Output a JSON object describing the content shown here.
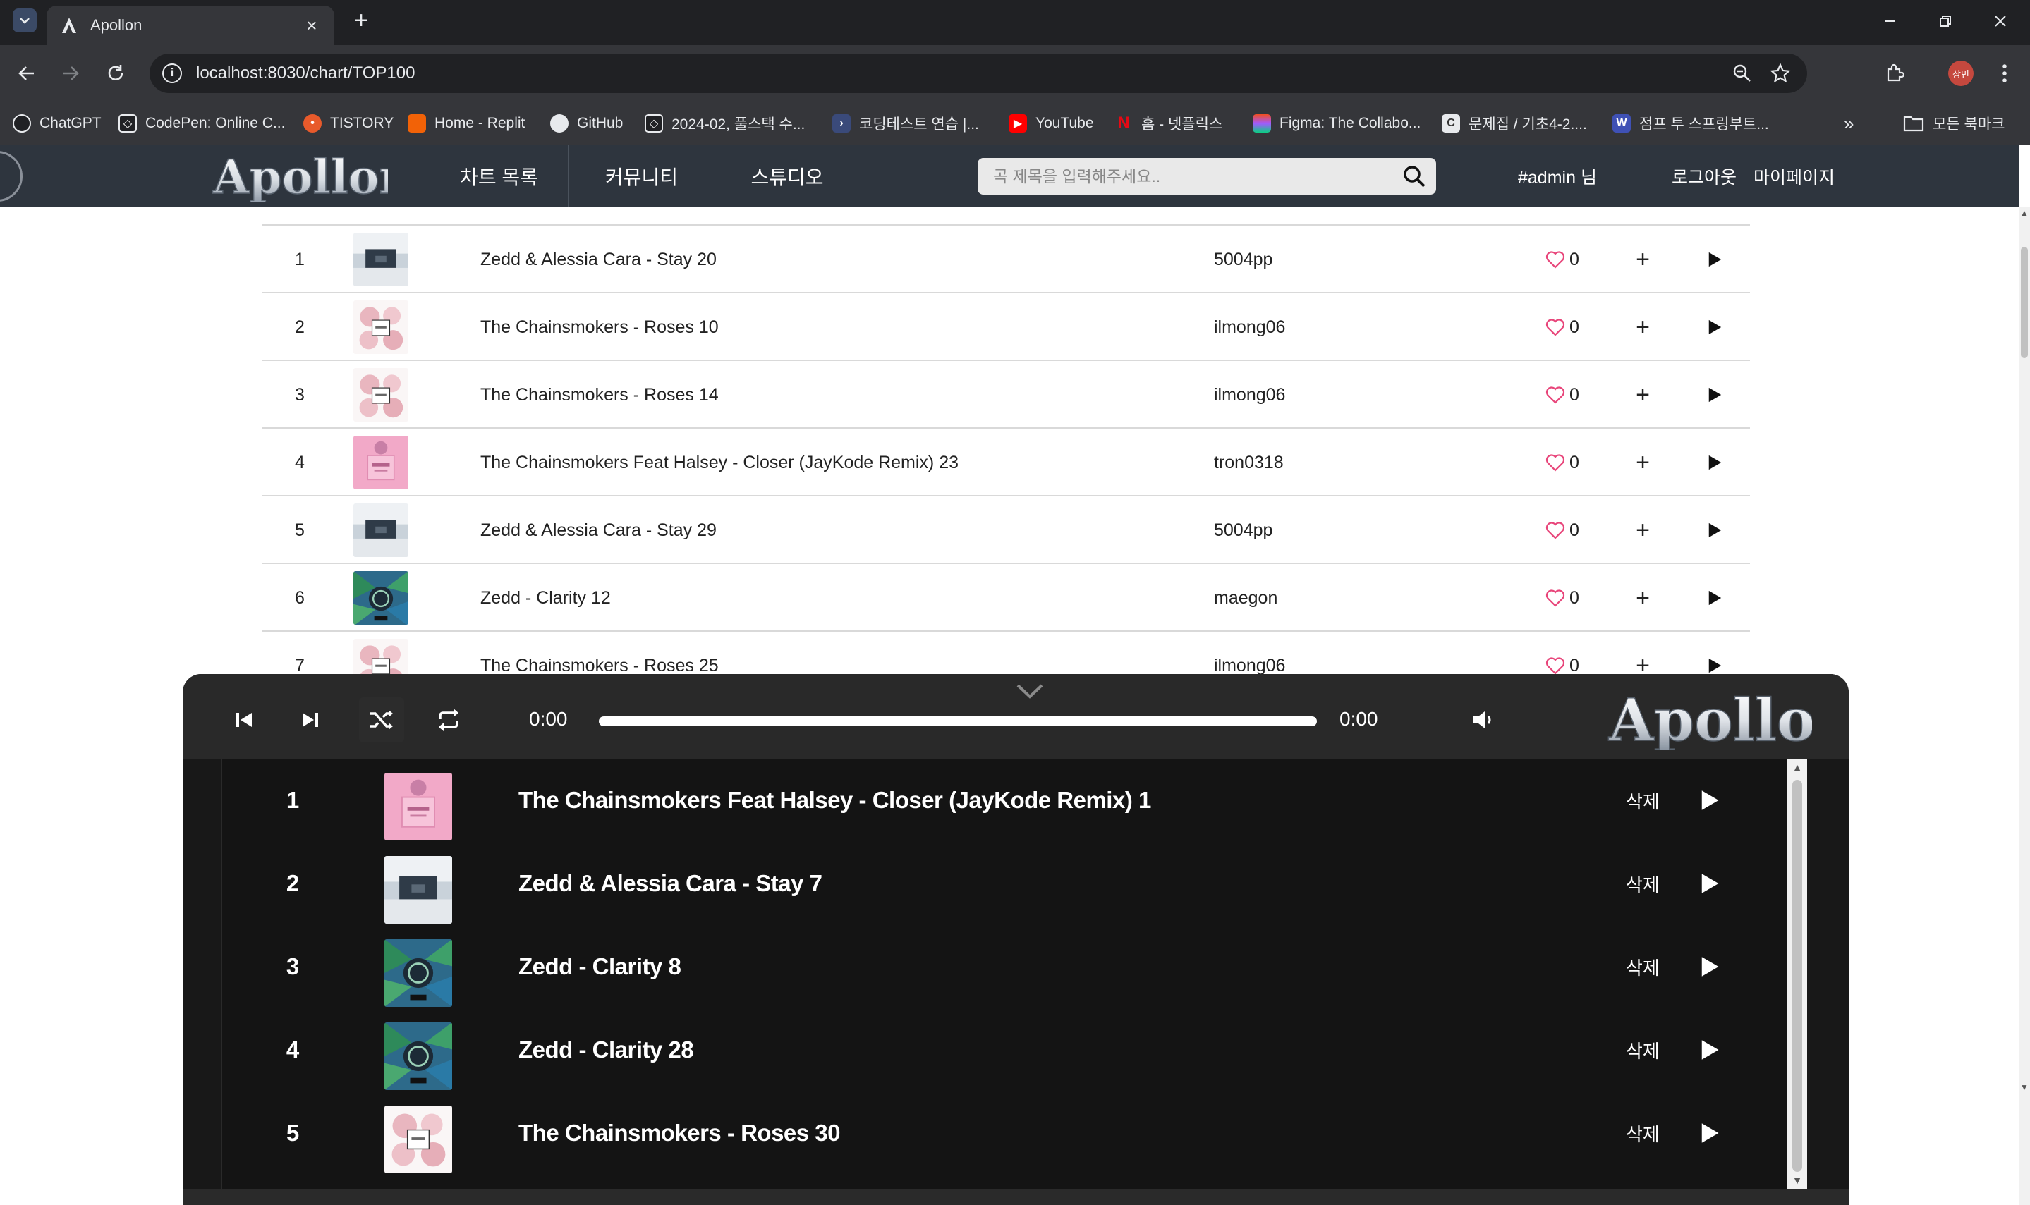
{
  "browser": {
    "tab_title": "Apollon",
    "url": "localhost:8030/chart/TOP100",
    "profile_label": "상민",
    "bookmarks": [
      "ChatGPT",
      "CodePen: Online C...",
      "TISTORY",
      "Home - Replit",
      "GitHub",
      "2024-02, 풀스택 수...",
      "코딩테스트 연습 |...",
      "YouTube",
      "홈 - 넷플릭스",
      "Figma: The Collabo...",
      "문제집 / 기초4-2....",
      "점프 투 스프링부트...",
      "모든 북마크"
    ]
  },
  "site": {
    "logo": "Apollon",
    "nav": [
      "차트 목록",
      "커뮤니티",
      "스튜디오"
    ],
    "search_placeholder": "곡 제목을 입력해주세요..",
    "user_greeting": "#admin 님",
    "logout": "로그아웃",
    "mypage": "마이페이지"
  },
  "chart": {
    "rows": [
      {
        "rank": "1",
        "title": "Zedd & Alessia Cara - Stay 20",
        "artist": "5004pp",
        "likes": "0",
        "art": "stay"
      },
      {
        "rank": "2",
        "title": "The Chainsmokers - Roses 10",
        "artist": "ilmong06",
        "likes": "0",
        "art": "roses"
      },
      {
        "rank": "3",
        "title": "The Chainsmokers - Roses 14",
        "artist": "ilmong06",
        "likes": "0",
        "art": "roses"
      },
      {
        "rank": "4",
        "title": "The Chainsmokers Feat Halsey - Closer (JayKode Remix) 23",
        "artist": "tron0318",
        "likes": "0",
        "art": "closer"
      },
      {
        "rank": "5",
        "title": "Zedd & Alessia Cara - Stay 29",
        "artist": "5004pp",
        "likes": "0",
        "art": "stay"
      },
      {
        "rank": "6",
        "title": "Zedd - Clarity 12",
        "artist": "maegon",
        "likes": "0",
        "art": "clarity"
      },
      {
        "rank": "7",
        "title": "The Chainsmokers - Roses 25",
        "artist": "ilmong06",
        "likes": "0",
        "art": "roses"
      }
    ]
  },
  "player": {
    "logo": "Apollon",
    "time_current": "0:00",
    "time_total": "0:00",
    "delete_label": "삭제",
    "queue": [
      {
        "num": "1",
        "title": "The Chainsmokers Feat Halsey - Closer (JayKode Remix) 1",
        "art": "closer"
      },
      {
        "num": "2",
        "title": "Zedd & Alessia Cara - Stay 7",
        "art": "stay"
      },
      {
        "num": "3",
        "title": "Zedd - Clarity 8",
        "art": "clarity"
      },
      {
        "num": "4",
        "title": "Zedd - Clarity 28",
        "art": "clarity"
      },
      {
        "num": "5",
        "title": "The Chainsmokers - Roses 30",
        "art": "roses"
      }
    ]
  },
  "colors": {
    "header_bg": "#2e353e",
    "player_bg": "#181818",
    "like_heart": "#e8457a"
  }
}
